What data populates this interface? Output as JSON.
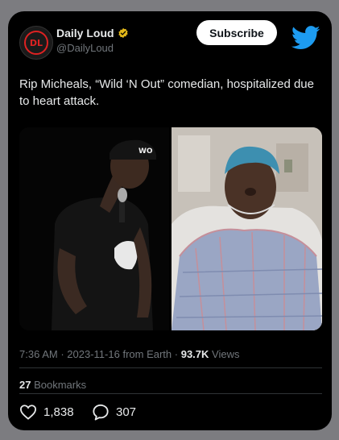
{
  "account": {
    "display_name": "Daily Loud",
    "handle": "@DailyLoud",
    "avatar_text": "DL"
  },
  "header": {
    "subscribe_label": "Subscribe"
  },
  "tweet": {
    "text": "Rip Micheals, “Wild ‘N Out” comedian, hospitalized due to heart attack.",
    "time": "7:36 AM",
    "date": "2023-11-16",
    "source": "from Earth",
    "views_count": "93.7K",
    "views_label": "Views"
  },
  "stats": {
    "bookmarks_count": "27",
    "bookmarks_label": "Bookmarks",
    "likes": "1,838",
    "replies": "307"
  },
  "icons": {
    "verified": "verified-badge-icon",
    "brand": "twitter-bird-icon",
    "like": "heart-icon",
    "reply": "reply-bubble-icon"
  },
  "colors": {
    "accent_blue": "#1d9bf0",
    "verified_gold": "#e2b719",
    "card_background": "#000000",
    "secondary_text": "#71767b"
  }
}
